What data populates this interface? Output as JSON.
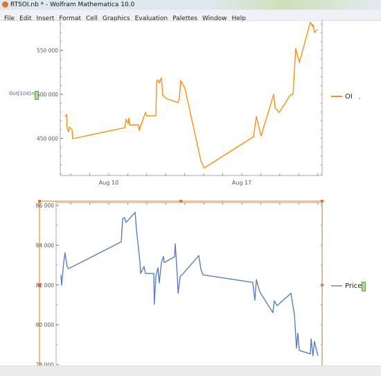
{
  "window": {
    "title": "RTSOI.nb * - Wolfram Mathematica 10.0"
  },
  "menu": [
    "File",
    "Edit",
    "Insert",
    "Format",
    "Cell",
    "Graphics",
    "Evaluation",
    "Palettes",
    "Window",
    "Help"
  ],
  "cell": {
    "out_label": "Out[104]="
  },
  "colors": {
    "oi": "#f7900e",
    "price": "#5a7fba",
    "selection": "#f4a45c",
    "cell_bracket": "#a8e08c"
  },
  "chart_data": [
    {
      "type": "line",
      "xlim": [
        7.45,
        21.23
      ],
      "ylim": [
        407900,
        583500
      ],
      "x_unit": "day of August",
      "x_ticks": [
        {
          "value": 10,
          "label": "Aug 10"
        },
        {
          "value": 17,
          "label": "Aug 17"
        }
      ],
      "y_ticks": [
        {
          "value": 450000,
          "label": "450 000"
        },
        {
          "value": 500000,
          "label": "500 000"
        },
        {
          "value": 550000,
          "label": "550 000"
        }
      ],
      "legend": {
        "position": "right"
      },
      "series": [
        {
          "name": "OI",
          "color": "#f7900e",
          "points": [
            [
              7.7,
              474800
            ],
            [
              7.78,
              477200
            ],
            [
              7.81,
              461400
            ],
            [
              7.89,
              457500
            ],
            [
              7.92,
              463000
            ],
            [
              8.07,
              459800
            ],
            [
              8.1,
              449600
            ],
            [
              10.84,
              462200
            ],
            [
              10.91,
              471700
            ],
            [
              11.02,
              466900
            ],
            [
              11.06,
              473200
            ],
            [
              11.1,
              465400
            ],
            [
              11.57,
              465400
            ],
            [
              11.6,
              459100
            ],
            [
              11.75,
              468500
            ],
            [
              11.93,
              479500
            ],
            [
              12.01,
              475600
            ],
            [
              12.48,
              475600
            ],
            [
              12.52,
              514200
            ],
            [
              12.59,
              516500
            ],
            [
              12.66,
              513000
            ],
            [
              12.77,
              518900
            ],
            [
              12.84,
              499200
            ],
            [
              13.03,
              495300
            ],
            [
              13.65,
              490600
            ],
            [
              13.72,
              496900
            ],
            [
              13.79,
              515700
            ],
            [
              14.01,
              507100
            ],
            [
              14.85,
              424400
            ],
            [
              15.03,
              416500
            ],
            [
              17.62,
              452000
            ],
            [
              17.77,
              474800
            ],
            [
              18.02,
              452800
            ],
            [
              18.68,
              500000
            ],
            [
              18.75,
              485000
            ],
            [
              18.97,
              479500
            ],
            [
              19.55,
              499200
            ],
            [
              19.7,
              500000
            ],
            [
              19.84,
              552000
            ],
            [
              20.03,
              536200
            ],
            [
              20.61,
              581900
            ],
            [
              20.72,
              577200
            ],
            [
              20.75,
              579500
            ],
            [
              20.83,
              570100
            ],
            [
              20.97,
              574000
            ]
          ]
        }
      ],
      "legend_extra": ","
    },
    {
      "type": "line",
      "xlim": [
        7.23,
        21.23
      ],
      "ylim": [
        78020,
        86140
      ],
      "x_unit": "day of August",
      "y_ticks": [
        {
          "value": 78000,
          "label": "78 000"
        },
        {
          "value": 80000,
          "label": "80 000"
        },
        {
          "value": 82000,
          "label": "82 000"
        },
        {
          "value": 84000,
          "label": "84 000"
        },
        {
          "value": 86000,
          "label": "86 000"
        }
      ],
      "legend": {
        "position": "right"
      },
      "series": [
        {
          "name": "Price",
          "color": "#5a7fba",
          "points": [
            [
              7.48,
              82510
            ],
            [
              7.52,
              81990
            ],
            [
              7.63,
              83130
            ],
            [
              7.7,
              83620
            ],
            [
              7.81,
              82930
            ],
            [
              7.89,
              82820
            ],
            [
              10.66,
              84170
            ],
            [
              10.73,
              85340
            ],
            [
              10.84,
              85380
            ],
            [
              10.91,
              85140
            ],
            [
              11.39,
              85650
            ],
            [
              11.46,
              84760
            ],
            [
              11.53,
              84170
            ],
            [
              11.64,
              83130
            ],
            [
              11.68,
              82580
            ],
            [
              11.86,
              82930
            ],
            [
              11.93,
              82580
            ],
            [
              12.37,
              82580
            ],
            [
              12.4,
              81030
            ],
            [
              12.48,
              82440
            ],
            [
              12.59,
              82860
            ],
            [
              12.66,
              82100
            ],
            [
              12.77,
              83130
            ],
            [
              12.88,
              83440
            ],
            [
              12.92,
              83130
            ],
            [
              13.46,
              83410
            ],
            [
              13.5,
              84070
            ],
            [
              13.61,
              82440
            ],
            [
              13.65,
              81580
            ],
            [
              13.76,
              82440
            ],
            [
              13.86,
              82510
            ],
            [
              14.74,
              83480
            ],
            [
              14.85,
              82790
            ],
            [
              14.96,
              82510
            ],
            [
              17.58,
              82130
            ],
            [
              17.69,
              81230
            ],
            [
              17.77,
              82270
            ],
            [
              17.95,
              81650
            ],
            [
              18.64,
              80610
            ],
            [
              18.71,
              81200
            ],
            [
              18.86,
              80960
            ],
            [
              19.59,
              81580
            ],
            [
              19.77,
              80510
            ],
            [
              19.88,
              78820
            ],
            [
              19.95,
              79580
            ],
            [
              20.03,
              78710
            ],
            [
              20.61,
              78540
            ],
            [
              20.65,
              79300
            ],
            [
              20.75,
              78440
            ],
            [
              20.83,
              79160
            ],
            [
              21.01,
              78440
            ]
          ]
        }
      ]
    }
  ]
}
